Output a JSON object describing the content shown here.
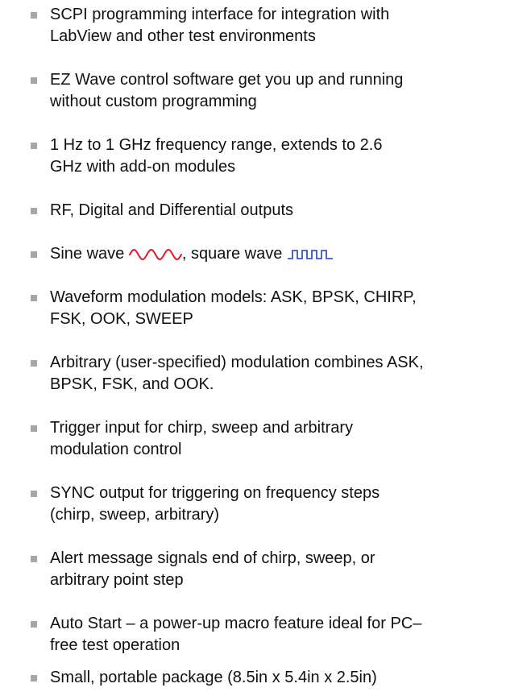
{
  "features": {
    "items": [
      {
        "lines": [
          "SCPI programming interface for integration with",
          "LabView and other test environments"
        ]
      },
      {
        "lines": [
          "EZ Wave control software get you up and running",
          "without custom programming"
        ]
      },
      {
        "lines": [
          "1 Hz to 1 GHz frequency range, extends to 2.6",
          "GHz with add-on modules"
        ]
      },
      {
        "lines": [
          "RF, Digital and Differential outputs"
        ]
      },
      {
        "sine_label": "Sine wave",
        "separator": ", square wave",
        "sine_color": "#e0182e",
        "square_color": "#1f3fbf"
      },
      {
        "lines": [
          "Waveform modulation models: ASK, BPSK, CHIRP,",
          "FSK, OOK, SWEEP"
        ]
      },
      {
        "lines": [
          "Arbitrary (user-specified) modulation combines ASK,",
          "BPSK, FSK, and OOK."
        ]
      },
      {
        "lines": [
          "Trigger input for chirp, sweep and arbitrary",
          "modulation control"
        ]
      },
      {
        "lines": [
          "SYNC output for triggering on frequency steps",
          "(chirp, sweep, arbitrary)"
        ]
      },
      {
        "lines": [
          "Alert message signals end of chirp, sweep, or",
          "arbitrary point step"
        ]
      },
      {
        "lines": [
          "Auto Start – a power-up macro feature ideal for PC–",
          "free test operation"
        ]
      },
      {
        "lines": [
          "Small, portable package (8.5in x 5.4in x 2.5in)"
        ]
      }
    ]
  },
  "colors": {
    "text": "#111111",
    "bullet": "#a6a6a6"
  }
}
